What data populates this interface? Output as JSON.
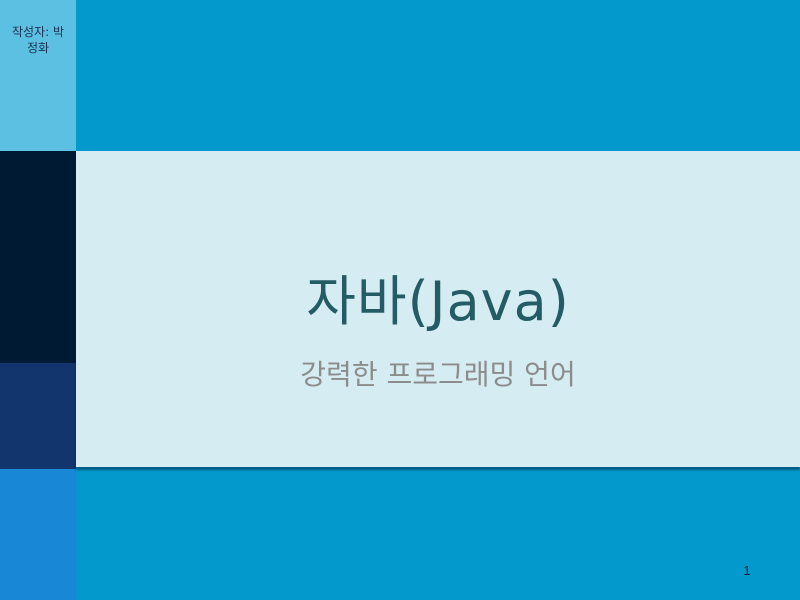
{
  "slide": {
    "author": "작성자: 박\n정화",
    "title": "자바(Java)",
    "subtitle": "강력한 프로그래밍 언어",
    "page_number": "1"
  },
  "colors": {
    "background": "#0399cd",
    "title_band": "#d5ecf2",
    "title_text": "#245c66",
    "subtitle_text": "#8c8c8c",
    "left_top": "#5bc0e1",
    "left_dark": "#011a33",
    "left_navy": "#12356d",
    "left_bottom": "#1887d6"
  }
}
